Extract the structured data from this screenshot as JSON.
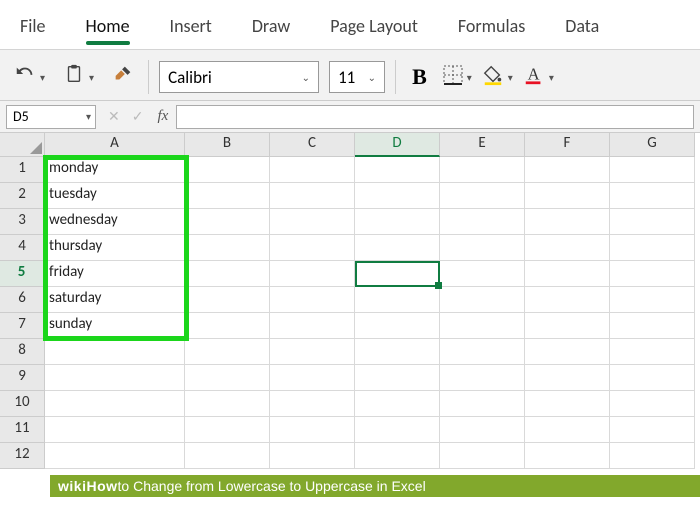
{
  "tabs": {
    "file": "File",
    "home": "Home",
    "insert": "Insert",
    "draw": "Draw",
    "pageLayout": "Page Layout",
    "formulas": "Formulas",
    "data": "Data"
  },
  "toolbar": {
    "font": "Calibri",
    "fontSize": "11",
    "bold": "B",
    "colors": {
      "accent": "#107c41",
      "fillHighlight": "#ffd800",
      "fontColorUnderline": "#e81123"
    }
  },
  "formulaBar": {
    "nameBox": "D5",
    "fxLabel": "fx",
    "formula": ""
  },
  "columns": [
    "A",
    "B",
    "C",
    "D",
    "E",
    "F",
    "G"
  ],
  "rowNumbers": [
    "1",
    "2",
    "3",
    "4",
    "5",
    "6",
    "7",
    "8",
    "9",
    "10",
    "11",
    "12"
  ],
  "activeCell": {
    "col": "D",
    "row": 5
  },
  "cells": {
    "A1": "monday",
    "A2": "tuesday",
    "A3": "wednesday",
    "A4": "thursday",
    "A5": "friday",
    "A6": "saturday",
    "A7": "sunday"
  },
  "highlightRange": "A1:A7",
  "footer": {
    "brand": "wikiHow",
    "title": " to Change from Lowercase to Uppercase in Excel"
  }
}
